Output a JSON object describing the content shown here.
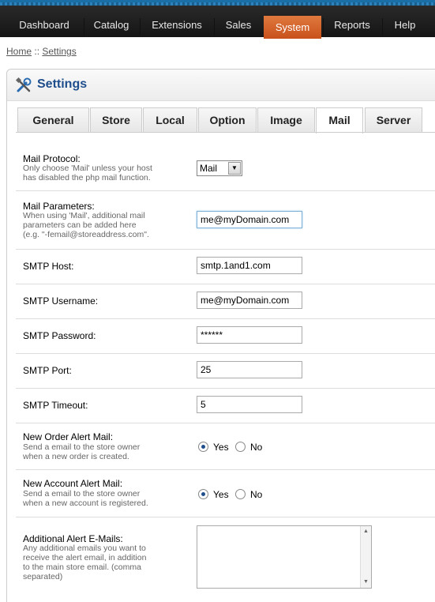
{
  "nav": {
    "items": [
      "Dashboard",
      "Catalog",
      "Extensions",
      "Sales",
      "System",
      "Reports",
      "Help"
    ],
    "active": "System"
  },
  "breadcrumb": {
    "home": "Home",
    "sep": "::",
    "current": "Settings"
  },
  "panel": {
    "title": "Settings",
    "icon": "tools-icon"
  },
  "tabs": [
    "General",
    "Store",
    "Local",
    "Option",
    "Image",
    "Mail",
    "Server"
  ],
  "active_tab": "Mail",
  "form": {
    "mail_protocol": {
      "label": "Mail Protocol:",
      "hint1": "Only choose 'Mail' unless your host",
      "hint2": "has disabled the php mail function.",
      "value": "Mail"
    },
    "mail_parameters": {
      "label": "Mail Parameters:",
      "hint1": "When using 'Mail', additional mail",
      "hint2": "parameters can be added here",
      "hint3": "(e.g. \"-femail@storeaddress.com\".",
      "value": "me@myDomain.com"
    },
    "smtp_host": {
      "label": "SMTP Host:",
      "value": "smtp.1and1.com"
    },
    "smtp_username": {
      "label": "SMTP Username:",
      "value": "me@myDomain.com"
    },
    "smtp_password": {
      "label": "SMTP Password:",
      "value": "******"
    },
    "smtp_port": {
      "label": "SMTP Port:",
      "value": "25"
    },
    "smtp_timeout": {
      "label": "SMTP Timeout:",
      "value": "5"
    },
    "new_order_alert": {
      "label": "New Order Alert Mail:",
      "hint1": "Send a email to the store owner",
      "hint2": "when a new order is created.",
      "yes": "Yes",
      "no": "No",
      "selected": "Yes"
    },
    "new_account_alert": {
      "label": "New Account Alert Mail:",
      "hint1": "Send a email to the store owner",
      "hint2": "when a new account is registered.",
      "yes": "Yes",
      "no": "No",
      "selected": "Yes"
    },
    "additional_emails": {
      "label": "Additional Alert E-Mails:",
      "hint1": "Any additional emails you want to",
      "hint2": "receive the alert email, in addition",
      "hint3": "to the main store email. (comma",
      "hint4": "separated)",
      "value": ""
    }
  }
}
